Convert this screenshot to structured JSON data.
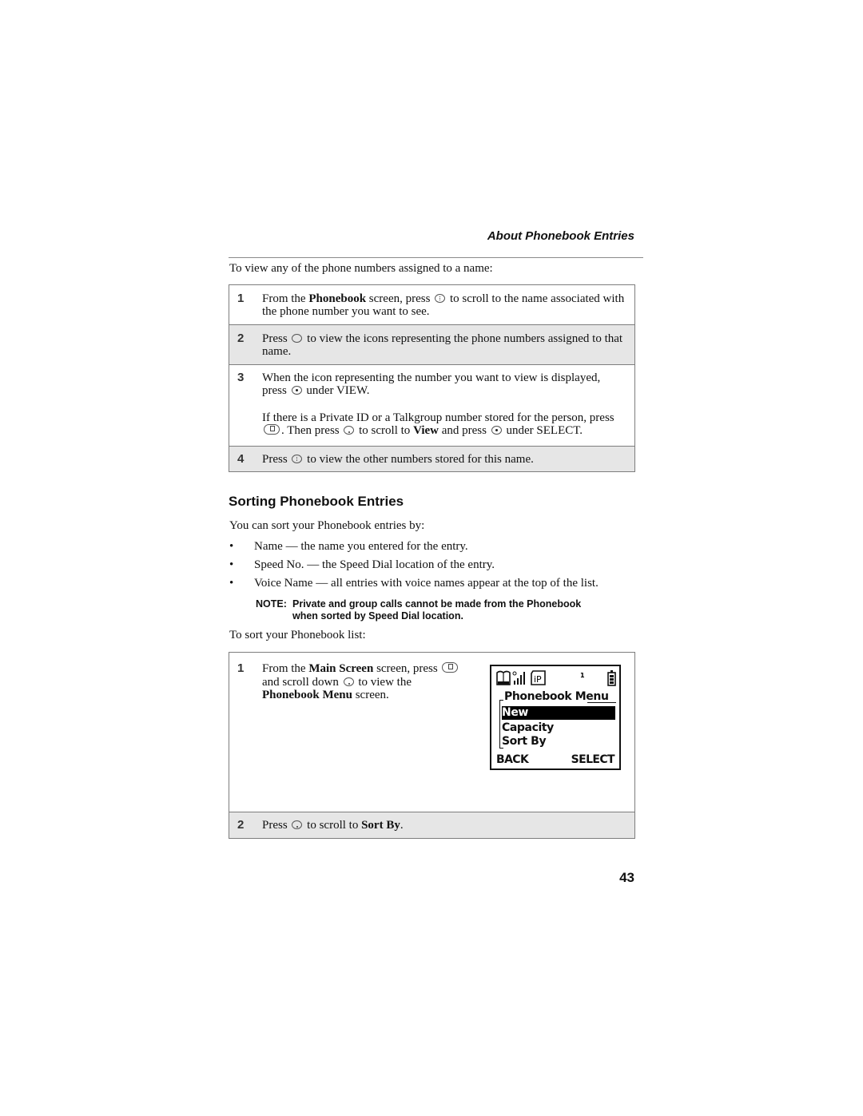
{
  "running_head": "About Phonebook Entries",
  "intro_view": "To view any of the phone numbers assigned to a name:",
  "view_steps": [
    {
      "num": "1",
      "parts": [
        "From the ",
        "Phonebook",
        " screen, press ",
        " to scroll to the name associated with the phone number you want to see."
      ]
    },
    {
      "num": "2",
      "parts": [
        "Press ",
        " to view the icons representing the phone numbers assigned to that name."
      ]
    },
    {
      "num": "3",
      "parts": [
        "When the icon representing the number you want to view is displayed, press ",
        " under VIEW."
      ],
      "extra": [
        "If there is a Private ID or a Talkgroup number stored for the person, press ",
        ". Then press ",
        " to scroll to ",
        "View",
        " and press ",
        " under SELECT."
      ]
    },
    {
      "num": "4",
      "parts": [
        "Press ",
        " to view the other numbers stored for this name."
      ]
    }
  ],
  "section_heading": "Sorting Phonebook Entries",
  "intro_sort": "You can sort your Phonebook entries by:",
  "bullets": [
    "Name — the name you entered for the entry.",
    "Speed No. — the Speed Dial location of the entry.",
    "Voice Name — all entries with voice names appear at the top of the list."
  ],
  "bullet_glyph": "•",
  "note": {
    "label": "NOTE:",
    "line1": "Private and group calls cannot be made from the Phonebook",
    "line2": "when sorted by Speed Dial location."
  },
  "intro_sort_list": "To sort your Phonebook list:",
  "sort_steps": [
    {
      "num": "1",
      "parts": [
        "From the ",
        "Main Screen",
        " screen, press ",
        " and scroll down ",
        " to view the ",
        "Phonebook Menu",
        " screen."
      ]
    },
    {
      "num": "2",
      "parts": [
        "Press ",
        " to scroll to ",
        "Sort By",
        "."
      ]
    }
  ],
  "phone_screen": {
    "status_icons": [
      "phonebook-icon",
      "signal-strength-icon",
      "ip-icon",
      "line-indicator",
      "battery-icon"
    ],
    "line_indicator": "1",
    "ip_label": "iP",
    "title": "Phonebook Menu",
    "items": [
      "New",
      "Capacity",
      "Sort By"
    ],
    "selected_index": 0,
    "softkey_left": "BACK",
    "softkey_right": "SELECT"
  },
  "page_number": "43"
}
